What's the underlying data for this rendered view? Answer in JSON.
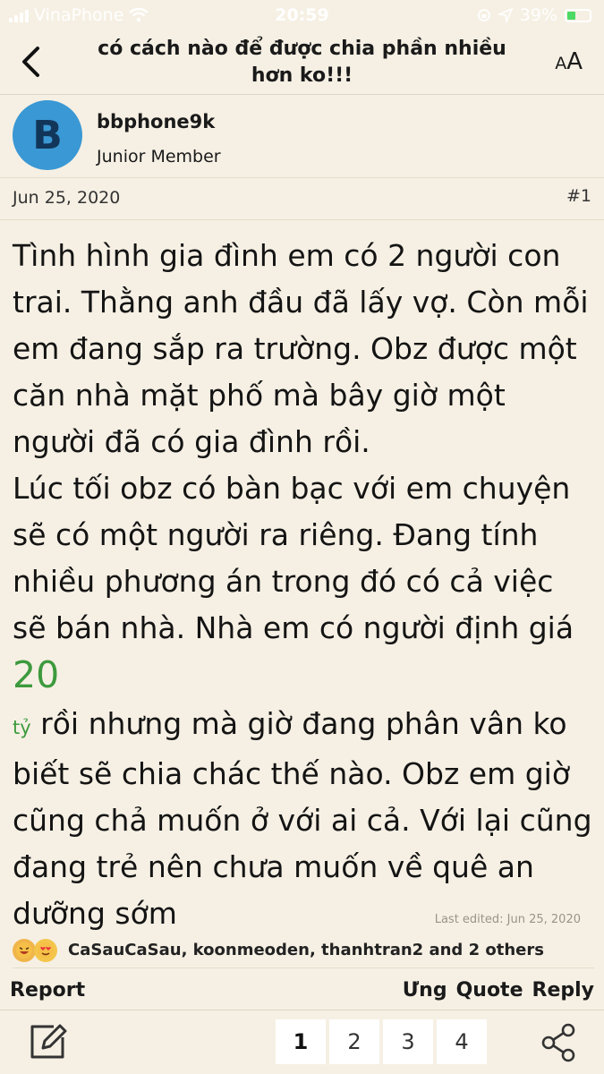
{
  "status_bar": {
    "carrier": "VinaPhone",
    "time": "20:59",
    "battery_percent": "39%",
    "battery_level": 0.39,
    "battery_color": "#4cd964"
  },
  "header": {
    "title": "có cách nào để được chia phần nhiều hơn ko!!!",
    "text_size_label_large": "A",
    "text_size_label_small": "A",
    "back_icon": "chevron-left-icon"
  },
  "author": {
    "avatar_letter": "B",
    "avatar_color": "#3a98d4",
    "name": "bbphone9k",
    "rank": "Junior Member"
  },
  "post": {
    "date": "Jun 25, 2020",
    "number": "#1",
    "body_part1": "Tình hình gia đình em có 2 người con trai. Thằng anh đầu đã lấy vợ. Còn mỗi em đang sắp ra trường. Obz được một căn nhà mặt phố mà bây giờ một người đã có gia đình rồi.",
    "body_part2": "Lúc tối obz có bàn bạc với em chuyện sẽ có một người ra riêng. Đang tính nhiều phương án trong đó có cả việc sẽ bán nhà. Nhà em có người định giá ",
    "price_value": "20",
    "price_unit": "tỷ",
    "body_part3": " rồi nhưng mà giờ đang phân vân ko biết sẽ chia chác thế nào. Obz em giờ cũng chả muốn ở với ai cả. Với lại cũng đang trẻ nên chưa muốn về quê an dưỡng sớm",
    "last_edited": "Last edited: Jun 25, 2020",
    "price_color": "#3d9a3d"
  },
  "reactions": {
    "icons": [
      "haha-reaction-icon",
      "love-reaction-icon"
    ],
    "names": "CaSauCaSau, koonmeoden, thanhtran2 and 2 others"
  },
  "actions": {
    "report": "Report",
    "like": "Ưng",
    "quote": "Quote",
    "reply": "Reply"
  },
  "bottom_bar": {
    "pages": [
      "1",
      "2",
      "3",
      "4"
    ],
    "current_page": "1",
    "compose_icon": "compose-icon",
    "share_icon": "share-icon"
  }
}
